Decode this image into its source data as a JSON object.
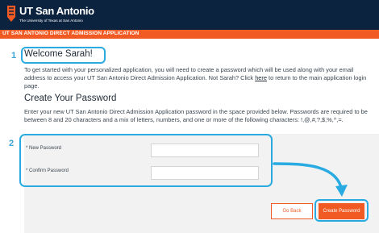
{
  "header": {
    "brand_name": "UT San Antonio",
    "brand_tagline": "The University of Texas at San Antonio",
    "logo_icon": "ut-san-antonio-logo-icon",
    "colors": {
      "navy": "#0c2340",
      "orange": "#f15a22",
      "highlight": "#29abe2"
    }
  },
  "subheader": {
    "title": "UT SAN ANTONIO DIRECT ADMISSION APPLICATION"
  },
  "annotations": {
    "step1": "1",
    "step2": "2"
  },
  "welcome": {
    "title": "Welcome Sarah!",
    "text_before_link": "To get started with your personalized application, you will need to create a password which will be used along with your email address to access your UT San Antonio Direct Admission Application. Not Sarah? Click ",
    "link_text": "here",
    "text_after_link": " to return to the main application login page."
  },
  "create_password": {
    "heading": "Create Your Password",
    "description": "Enter your new UT San Antonio Direct Admission Application password in the space provided below. Passwords are required to be between 8 and 20 characters and a mix of letters, numbers, and one or more of the following characters: !,@,#,?,$,%,^,=."
  },
  "form": {
    "new_password_label": "* New Password",
    "new_password_value": "",
    "confirm_password_label": "* Confirm Password",
    "confirm_password_value": ""
  },
  "buttons": {
    "go_back": "Go Back",
    "create_password": "Create Password"
  }
}
